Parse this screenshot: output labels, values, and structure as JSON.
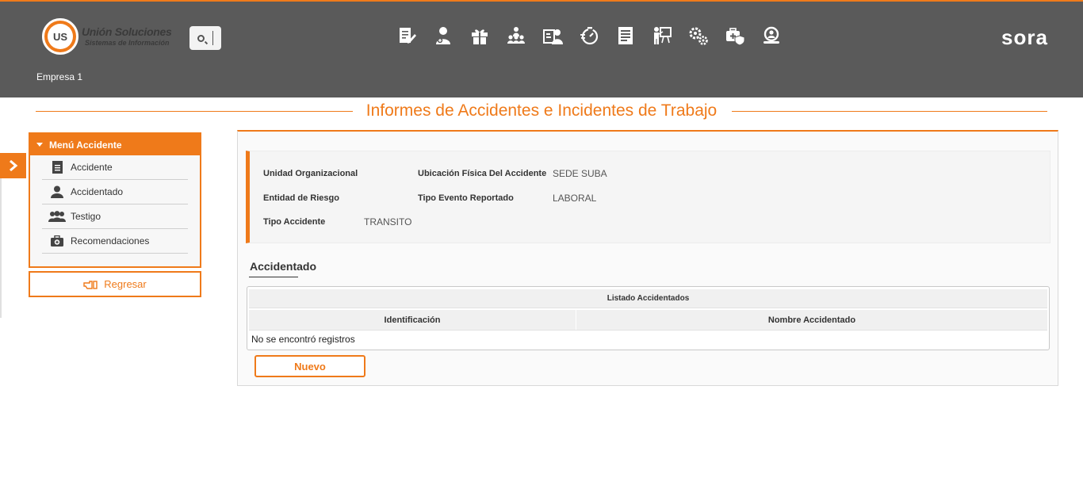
{
  "header": {
    "logo_title": "Unión Soluciones",
    "logo_subtitle": "Sistemas de Información",
    "logo_badge": "US",
    "brand": "sora",
    "company": "Empresa 1",
    "nav_icons": [
      "report-edit-icon",
      "user-health-icon",
      "gift-icon",
      "people-group-icon",
      "id-card-user-icon",
      "timer-icon",
      "document-list-icon",
      "teacher-board-icon",
      "gears-icon",
      "medical-case-shield-icon",
      "user-search-icon"
    ]
  },
  "page": {
    "title": "Informes de Accidentes e Incidentes de Trabajo"
  },
  "menu": {
    "title": "Menú Accidente",
    "items": [
      {
        "label": "Accidente",
        "icon": "document-icon"
      },
      {
        "label": "Accidentado",
        "icon": "user-icon"
      },
      {
        "label": "Testigo",
        "icon": "users-group-icon"
      },
      {
        "label": "Recomendaciones",
        "icon": "medical-kit-icon"
      }
    ],
    "back_label": "Regresar"
  },
  "info": {
    "unidad_label": "Unidad Organizacional",
    "unidad_value": "",
    "ubicacion_label": "Ubicación Física Del Accidente",
    "ubicacion_value": "SEDE SUBA",
    "entidad_label": "Entidad de Riesgo",
    "entidad_value": "",
    "evento_label": "Tipo Evento Reportado",
    "evento_value": "LABORAL",
    "tipo_label": "Tipo Accidente",
    "tipo_value": "TRANSITO"
  },
  "accidentado": {
    "section_title": "Accidentado",
    "grid_caption": "Listado Accidentados",
    "columns": [
      "Identificación",
      "Nombre Accidentado"
    ],
    "empty_message": "No se encontró registros",
    "new_label": "Nuevo"
  },
  "colors": {
    "accent": "#ef7a1a",
    "header_bg": "#5a5a5a"
  }
}
